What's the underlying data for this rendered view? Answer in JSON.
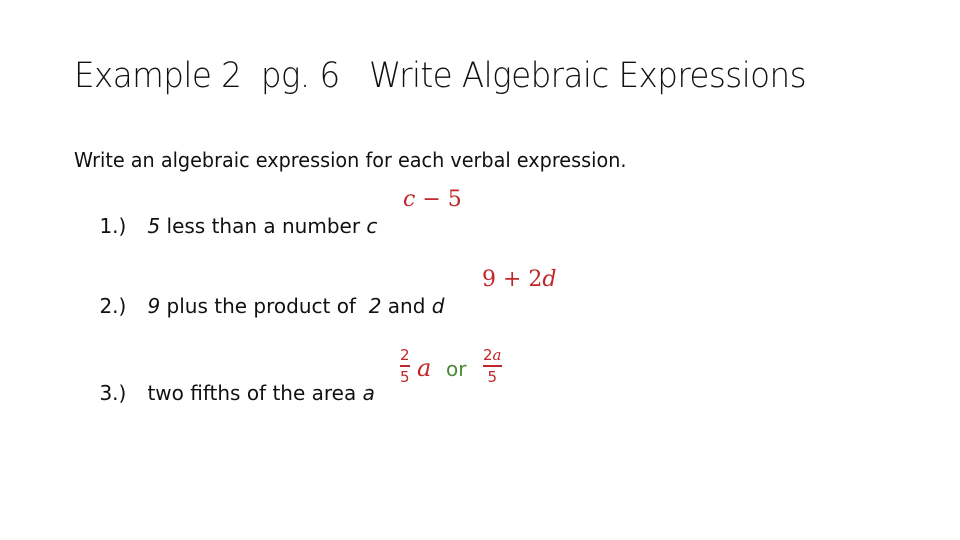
{
  "slide": {
    "title": "Example 2  pg. 6   Write Algebraic Expressions",
    "instruction": "Write an algebraic expression for each verbal expression.",
    "items": [
      {
        "number": "1.)",
        "parts": [
          "5",
          " less than a number ",
          "c"
        ],
        "answer": {
          "left": "c",
          "op": " − ",
          "right": "5"
        }
      },
      {
        "number": "2.)",
        "parts": [
          "9",
          " plus the product of  ",
          "2",
          " and ",
          "d"
        ],
        "answer": {
          "left": "9 + 2",
          "var": "d"
        }
      },
      {
        "number": "3.)",
        "parts": [
          "two fifths of the area ",
          "a"
        ],
        "answer": {
          "frac1": {
            "numerator": "2",
            "denominator": "5"
          },
          "var": "a",
          "connector": "or",
          "frac2": {
            "numerator_num": "2",
            "numerator_var": "a",
            "denominator": "5"
          }
        }
      }
    ],
    "colors": {
      "answer": "#c0262a",
      "connector": "#4a8a3a",
      "text": "#111111"
    }
  }
}
